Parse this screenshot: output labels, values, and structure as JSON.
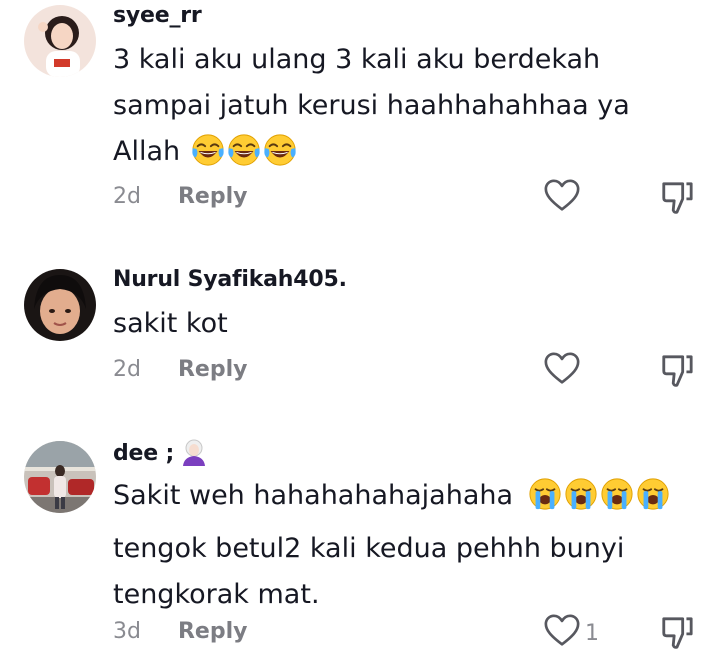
{
  "comments": [
    {
      "username": "syee_rr",
      "text_lines": [
        "3 kali aku ulang 3 kali aku berdekah",
        "sampai jatuh kerusi haahhahahhaa ya",
        "Allah"
      ],
      "emoji": "face-with-tears-of-joy",
      "emoji_count": 3,
      "time": "2d",
      "reply_label": "Reply",
      "likes": ""
    },
    {
      "username": "Nurul Syafikah405.",
      "text_lines": [
        "sakit kot"
      ],
      "time": "2d",
      "reply_label": "Reply",
      "likes": ""
    },
    {
      "username": "dee ;",
      "username_emoji": "person-white-hair",
      "text_lines": [
        "Sakit weh hahahahahajahaha",
        "tengok betul2 kali kedua pehhh bunyi",
        "tengkorak mat."
      ],
      "emoji": "loudly-crying-face",
      "emoji_count": 4,
      "time": "3d",
      "reply_label": "Reply",
      "likes": "1"
    }
  ],
  "colors": {
    "text": "#161823",
    "secondary": "#8a8b91",
    "icon": "#57585f"
  }
}
